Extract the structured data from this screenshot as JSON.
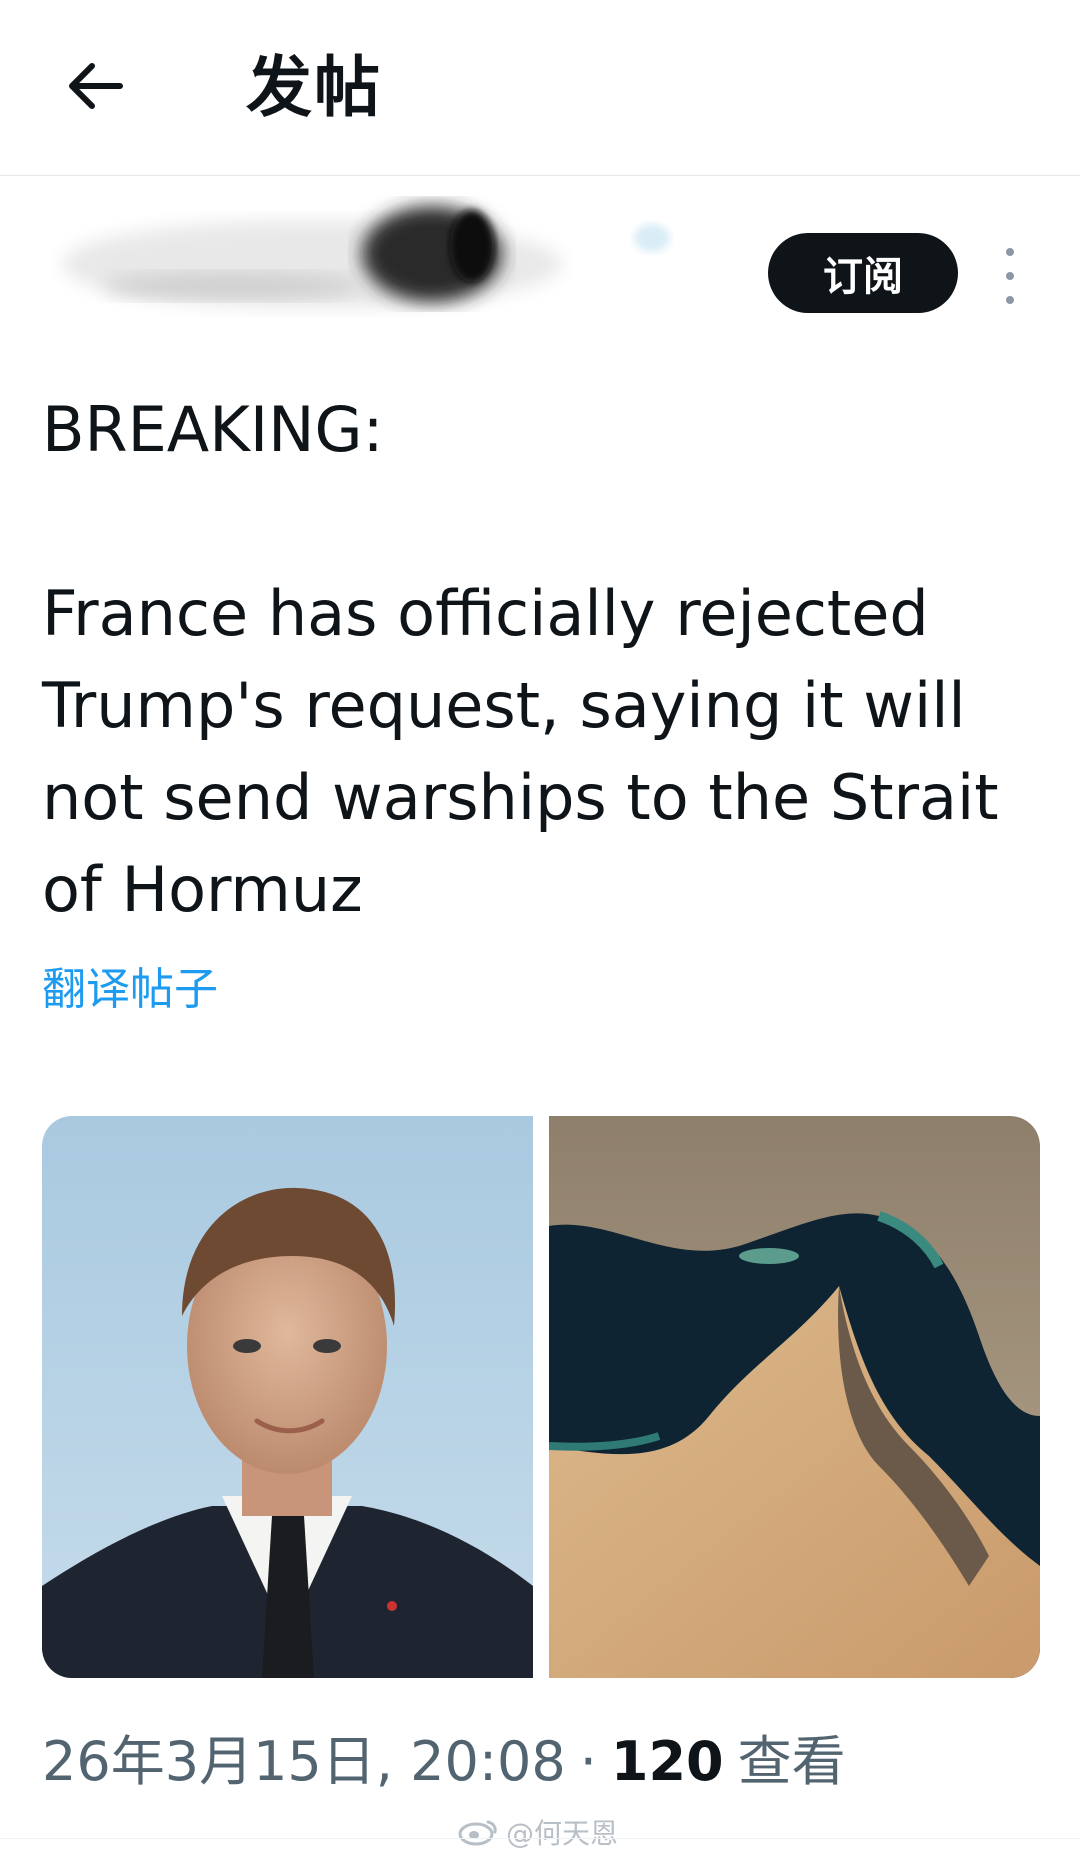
{
  "header": {
    "back_icon": "arrow-left-icon",
    "title": "发帖"
  },
  "author": {
    "subscribe_label": "订阅",
    "more_icon": "more-vertical-icon"
  },
  "post": {
    "text": "BREAKING:\n\nFrance has officially rejected Trump's request, saying it will not send warships to the Strait of Hormuz",
    "translate_label": "翻译帖子"
  },
  "media": {
    "images": [
      "portrait-photo",
      "satellite-map-photo"
    ]
  },
  "meta": {
    "timestamp": "26年3月15日, 20:08",
    "separator": "·",
    "views_count": "120",
    "views_label": "查看"
  },
  "watermark": {
    "text": "@何天恩"
  },
  "colors": {
    "text_primary": "#0f1419",
    "text_secondary": "#536471",
    "link": "#1d9bf0",
    "button_bg": "#0f1419"
  }
}
